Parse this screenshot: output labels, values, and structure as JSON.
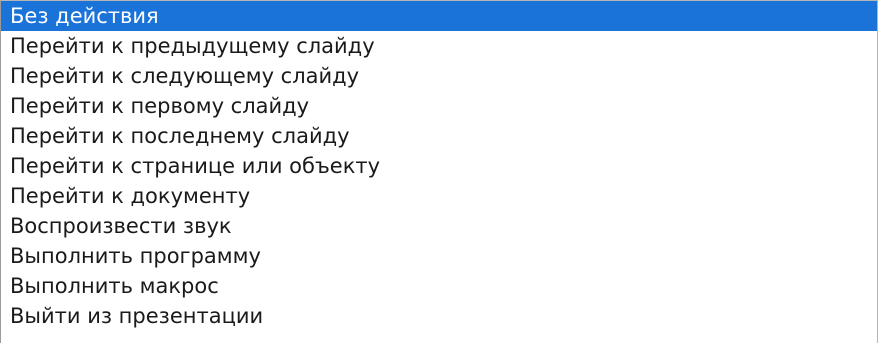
{
  "listbox": {
    "selected_index": 0,
    "colors": {
      "selection_bg": "#1a73d9",
      "selection_text": "#ffffff",
      "text": "#1a1a1a",
      "background": "#ffffff"
    },
    "items": [
      {
        "label": "Без действия"
      },
      {
        "label": "Перейти к предыдущему слайду"
      },
      {
        "label": "Перейти к следующему слайду"
      },
      {
        "label": "Перейти к первому слайду"
      },
      {
        "label": "Перейти к последнему слайду"
      },
      {
        "label": "Перейти к странице или объекту"
      },
      {
        "label": "Перейти к документу"
      },
      {
        "label": "Воспроизвести звук"
      },
      {
        "label": "Выполнить программу"
      },
      {
        "label": "Выполнить макрос"
      },
      {
        "label": "Выйти из презентации"
      }
    ]
  }
}
